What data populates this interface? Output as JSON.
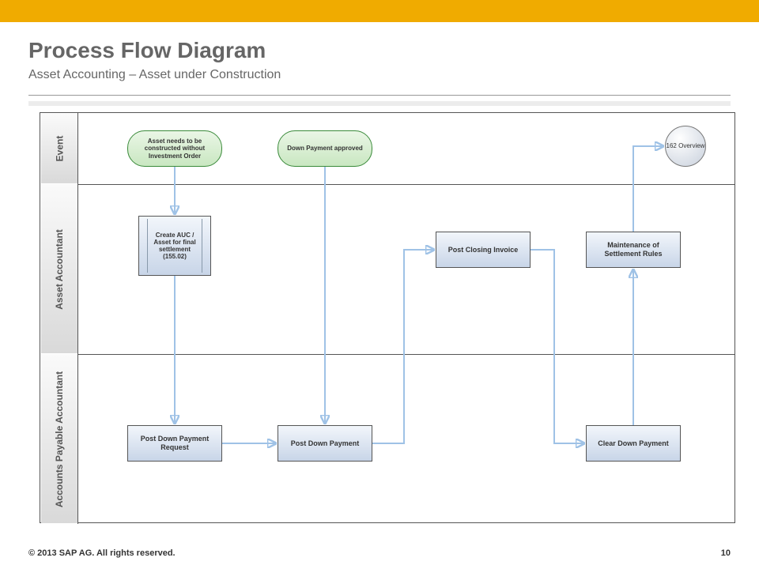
{
  "header": {
    "title": "Process Flow Diagram",
    "subtitle": "Asset Accounting – Asset under Construction"
  },
  "lanes": {
    "event": "Event",
    "asset_accountant": "Asset Accountant",
    "ap_accountant": "Accounts Payable Accountant"
  },
  "events": {
    "e1": "Asset needs to be constructed without Investment Order",
    "e2": "Down Payment approved"
  },
  "tasks": {
    "create_auc": "Create AUC / Asset for final settlement (155.02)",
    "post_dp_request": "Post Down Payment Request",
    "post_dp": "Post Down Payment",
    "post_closing_invoice": "Post Closing Invoice",
    "clear_dp": "Clear Down Payment",
    "maint_settlement": "Maintenance of Settlement Rules"
  },
  "reference": {
    "overview": "162 Overview"
  },
  "footer": {
    "copyright": "© 2013 SAP AG. All rights reserved.",
    "page": "10"
  }
}
